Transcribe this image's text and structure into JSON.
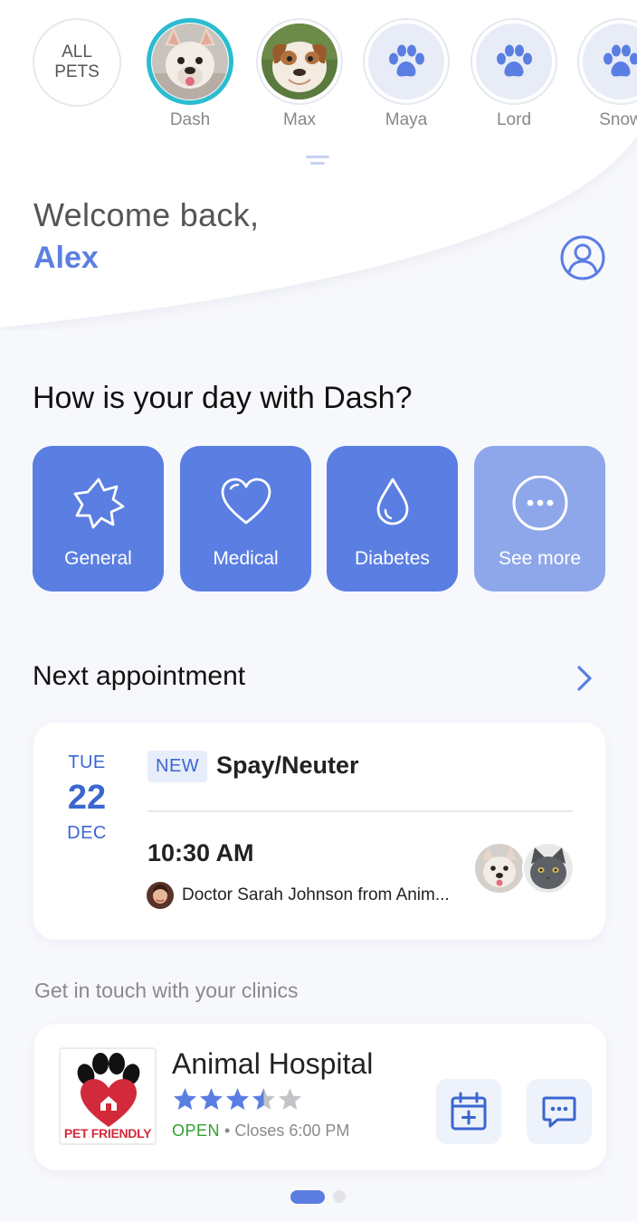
{
  "pets": {
    "all_pets_label_line1": "ALL",
    "all_pets_label_line2": "PETS",
    "items": [
      {
        "name": "Dash",
        "avatar": "french-bulldog-photo",
        "selected": true
      },
      {
        "name": "Max",
        "avatar": "bulldog-puppy-photo",
        "selected": false
      },
      {
        "name": "Maya",
        "avatar": "paw-icon",
        "selected": false
      },
      {
        "name": "Lord",
        "avatar": "paw-icon",
        "selected": false
      },
      {
        "name": "Snow",
        "avatar": "paw-icon",
        "selected": false
      }
    ]
  },
  "greeting": {
    "welcome": "Welcome back,",
    "username": "Alex",
    "profile_icon": "user-circle-icon"
  },
  "day": {
    "title": "How is your day with Dash?",
    "categories": [
      {
        "label": "General",
        "icon": "starburst-icon"
      },
      {
        "label": "Medical",
        "icon": "heart-icon"
      },
      {
        "label": "Diabetes",
        "icon": "drop-icon"
      },
      {
        "label": "See more",
        "icon": "more-dots-icon"
      }
    ]
  },
  "appointment": {
    "section_title": "Next appointment",
    "chevron_icon": "chevron-right-icon",
    "day_of_week": "TUE",
    "day": "22",
    "month": "DEC",
    "badge": "NEW",
    "type": "Spay/Neuter",
    "time": "10:30 AM",
    "doctor": "Doctor Sarah Johnson from Anim...",
    "pet_avatars": [
      "french-bulldog-photo",
      "grey-cat-photo"
    ]
  },
  "clinics": {
    "section_label": "Get in touch with your clinics",
    "name": "Animal Hospital",
    "logo_text": "PET FRIENDLY",
    "rating": 3.5,
    "rating_max": 5,
    "status": "OPEN",
    "closes": "• Closes 6:00 PM",
    "actions": [
      "calendar-add-icon",
      "chat-icon"
    ]
  },
  "pager": {
    "active": 1,
    "count": 2
  },
  "colors": {
    "accent": "#5a7ee2",
    "accent_light": "#8ea7ea",
    "selected_ring": "#2bbcd0",
    "open_green": "#2ea12e",
    "date_blue": "#3a67cf"
  }
}
